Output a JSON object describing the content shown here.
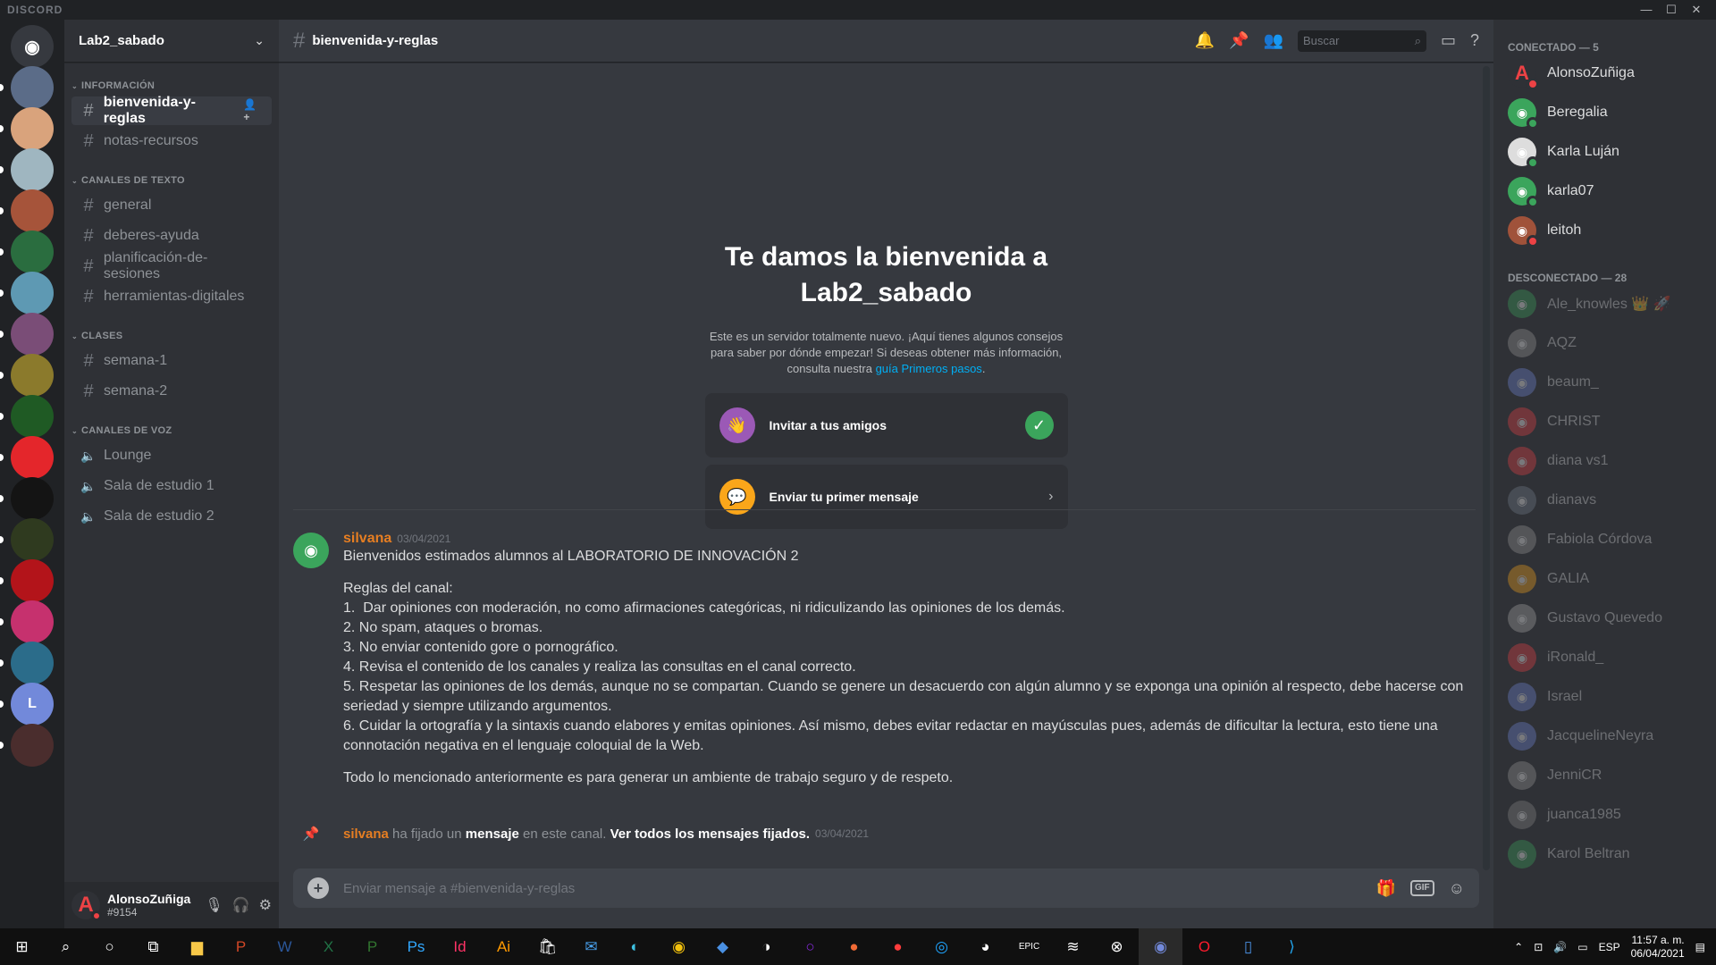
{
  "window": {
    "brand": "DISCORD",
    "min": "—",
    "max": "☐",
    "close": "✕"
  },
  "servers": [
    {
      "label": "",
      "color": "#36393f",
      "icon": "discord-home-icon"
    },
    {
      "label": "",
      "color": "#5b6c88"
    },
    {
      "label": "",
      "color": "#d9a37c"
    },
    {
      "label": "",
      "color": "#9fb6c0"
    },
    {
      "label": "",
      "color": "#a6543a"
    },
    {
      "label": "",
      "color": "#2a6d3f"
    },
    {
      "label": "",
      "color": "#5e99b3"
    },
    {
      "label": "",
      "color": "#7a4d77"
    },
    {
      "label": "",
      "color": "#8b7a2c"
    },
    {
      "label": "",
      "color": "#1f5a24"
    },
    {
      "label": "",
      "color": "#e4262b"
    },
    {
      "label": "",
      "color": "#141414"
    },
    {
      "label": "",
      "color": "#2f3a1f"
    },
    {
      "label": "",
      "color": "#b3141a"
    },
    {
      "label": "",
      "color": "#c6316e"
    },
    {
      "label": "",
      "color": "#2b6c8a"
    },
    {
      "label": "L",
      "color": "#7289da"
    },
    {
      "label": "",
      "color": "#4a2d2d"
    }
  ],
  "sidebar": {
    "server_name": "Lab2_sabado",
    "categories": [
      {
        "name": "INFORMACIÓN",
        "channels": [
          "bienvenida-y-reglas",
          "notas-recursos"
        ]
      },
      {
        "name": "CANALES DE TEXTO",
        "channels": [
          "general",
          "deberes-ayuda",
          "planificación-de-sesiones",
          "herramientas-digitales"
        ]
      },
      {
        "name": "CLASES",
        "channels": [
          "semana-1",
          "semana-2"
        ]
      },
      {
        "name": "CANALES DE VOZ",
        "channels": [
          "Lounge",
          "Sala de estudio 1",
          "Sala de estudio 2"
        ]
      }
    ],
    "user": {
      "name": "AlonsoZuñiga",
      "tag": "#9154",
      "avatar_letter": "A"
    }
  },
  "header": {
    "channel": "bienvenida-y-reglas",
    "search_placeholder": "Buscar"
  },
  "welcome": {
    "title_line1": "Te damos la bienvenida a",
    "title_line2": "Lab2_sabado",
    "desc_1": "Este es un servidor totalmente nuevo. ¡Aquí tienes algunos consejos para saber por dónde empezar! Si deseas obtener más información, consulta nuestra",
    "desc_link": "guía Primeros pasos",
    "desc_end": ".",
    "card_invite": "Invitar a tus amigos",
    "card_message": "Enviar tu primer mensaje"
  },
  "message": {
    "author": "silvana",
    "timestamp": "03/04/2021",
    "lines": [
      "Bienvenidos estimados alumnos al LABORATORIO DE INNOVACIÓN 2",
      "",
      "Reglas del canal:",
      "1.  Dar opiniones con moderación, no como afirmaciones categóricas, ni ridiculizando las opiniones de los demás.",
      "2. No spam, ataques o bromas.",
      "3. No enviar contenido gore o pornográfico.",
      "4. Revisa el contenido de los canales y realiza las consultas en el canal correcto.",
      "5. Respetar las opiniones de los demás, aunque no se compartan. Cuando se genere un desacuerdo con algún alumno y se exponga una opinión al respecto, debe hacerse con seriedad y siempre utilizando argumentos.",
      "6. Cuidar la ortografía y la sintaxis cuando elabores y emitas opiniones. Así mismo, debes evitar redactar en mayúsculas pues, además de dificultar la lectura, esto tiene una connotación negativa en el lenguaje coloquial de la Web.",
      "",
      "Todo lo mencionado anteriormente es para generar un ambiente de trabajo seguro y de respeto."
    ]
  },
  "pinned": {
    "author": "silvana",
    "text_a": "ha fijado un",
    "text_b": "mensaje",
    "text_c": "en este canal.",
    "text_d": "Ver todos los mensajes fijados.",
    "timestamp": "03/04/2021"
  },
  "composer": {
    "placeholder": "Enviar mensaje a #bienvenida-y-reglas",
    "gif": "GIF"
  },
  "members": {
    "online_header": "CONECTADO — 5",
    "offline_header": "DESCONECTADO — 28",
    "online": [
      {
        "name": "AlonsoZuñiga",
        "color": "#2f3136",
        "status": "#ed4245",
        "letter": "A"
      },
      {
        "name": "Beregalia",
        "color": "#3ba55c",
        "status": "#3ba55c",
        "letter": ""
      },
      {
        "name": "Karla Luján",
        "color": "#dddddd",
        "status": "#3ba55c",
        "letter": ""
      },
      {
        "name": "karla07",
        "color": "#3ba55c",
        "status": "#3ba55c",
        "letter": ""
      },
      {
        "name": "leitoh",
        "color": "#a0523a",
        "status": "#ed4245",
        "letter": ""
      }
    ],
    "offline": [
      {
        "name": "Ale_knowles 👑 🚀",
        "color": "#3ba55c"
      },
      {
        "name": "AQZ",
        "color": "#999999"
      },
      {
        "name": "beaum_",
        "color": "#7289da"
      },
      {
        "name": "CHRIST",
        "color": "#ed4245"
      },
      {
        "name": "diana vs1",
        "color": "#ed4245"
      },
      {
        "name": "dianavs",
        "color": "#747f8d"
      },
      {
        "name": "Fabiola Córdova",
        "color": "#999999"
      },
      {
        "name": "GALIA",
        "color": "#faa61a"
      },
      {
        "name": "Gustavo Quevedo",
        "color": "#aaaaaa"
      },
      {
        "name": "iRonald_",
        "color": "#ed4245"
      },
      {
        "name": "Israel",
        "color": "#7289da"
      },
      {
        "name": "JacquelineNeyra",
        "color": "#7289da"
      },
      {
        "name": "JenniCR",
        "color": "#999999"
      },
      {
        "name": "juanca1985",
        "color": "#888888"
      },
      {
        "name": "Karol Beltran",
        "color": "#3ba55c"
      }
    ]
  },
  "taskbar": {
    "lang": "ESP",
    "time": "11:57 a. m.",
    "date": "06/04/2021"
  }
}
